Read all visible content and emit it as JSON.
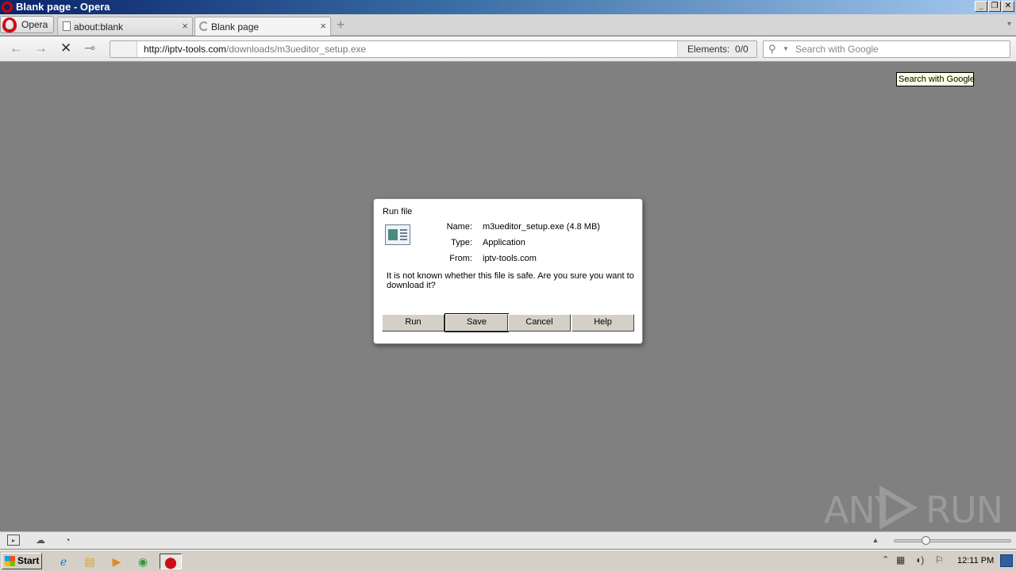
{
  "window": {
    "title": "Blank page - Opera",
    "controls": {
      "minimize": "_",
      "restore": "❐",
      "close": "✕"
    }
  },
  "tabbar": {
    "menu_label": "Opera",
    "tabs": [
      {
        "label": "about:blank",
        "close": "×",
        "active": false
      },
      {
        "label": "Blank page",
        "close": "×",
        "active": true
      }
    ],
    "new_tab_icon": "+",
    "tab_menu_icon": "▾"
  },
  "navbar": {
    "url_host": "http://iptv-tools.com",
    "url_path": "/downloads/m3ueditor_setup.exe",
    "elements_label": "Elements:",
    "elements_value": "0/0",
    "search_placeholder": "Search with Google",
    "icons": [
      "back-arrow-icon",
      "forward-arrow-icon",
      "stop-icon",
      "key-icon"
    ]
  },
  "tooltip": {
    "text": "Search with Google"
  },
  "dialog": {
    "title": "Run file",
    "name_label": "Name:",
    "name_value": "m3ueditor_setup.exe (4.8 MB)",
    "type_label": "Type:",
    "type_value": "Application",
    "from_label": "From:",
    "from_value": "iptv-tools.com",
    "message": "It is not known whether this file is safe. Are you sure you want to download it?",
    "buttons": {
      "run": "Run",
      "save": "Save",
      "cancel": "Cancel",
      "help": "Help"
    },
    "default_button": "Save"
  },
  "watermark": {
    "left": "ANY",
    "right": "RUN"
  },
  "taskbar": {
    "start_label": "Start",
    "clock": "12:11 PM",
    "apps": [
      "internet-explorer-icon",
      "explorer-folder-icon",
      "media-player-icon",
      "chrome-icon",
      "opera-icon"
    ]
  },
  "colors": {
    "page_background": "#808080",
    "title_gradient_start": "#0a246a",
    "opera_red": "#cc0f16",
    "tooltip_bg": "#ffffe1"
  }
}
